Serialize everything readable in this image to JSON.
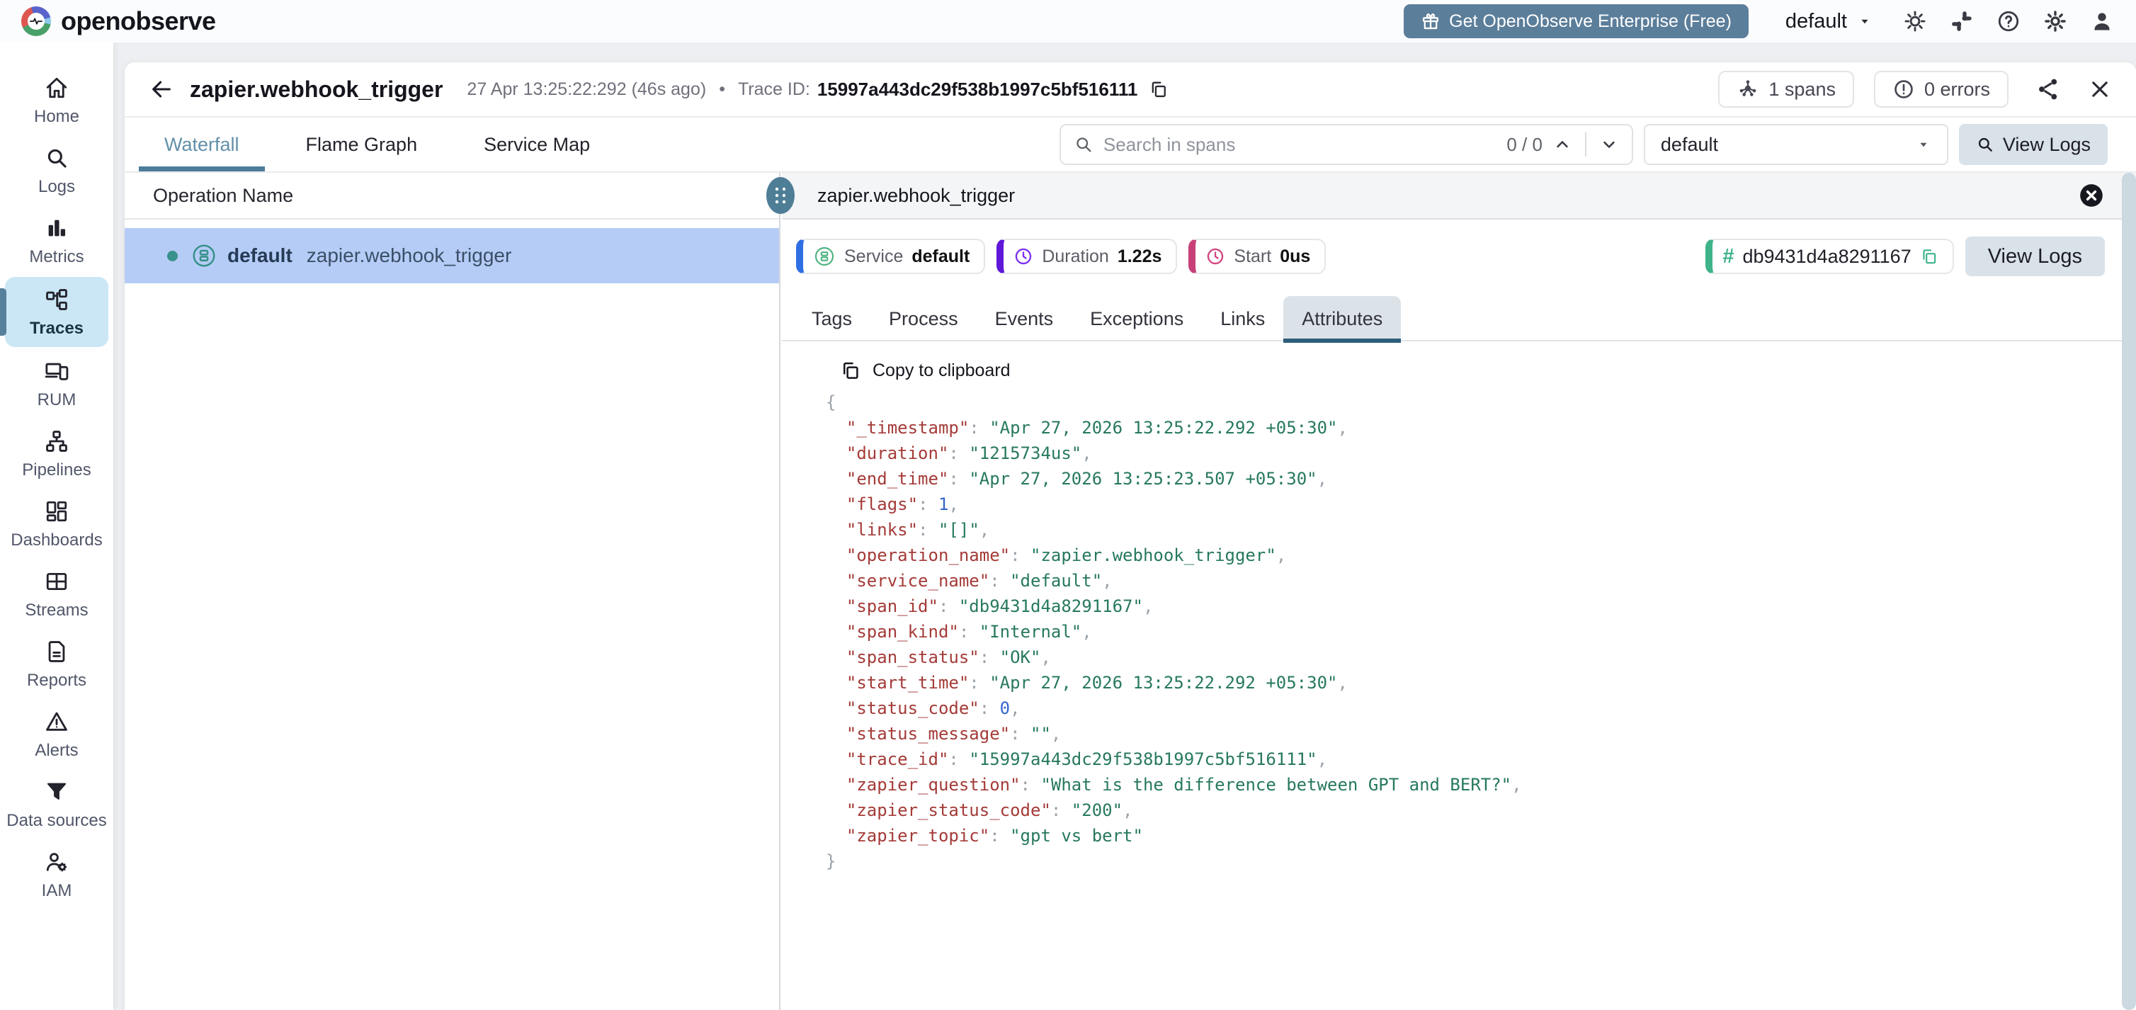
{
  "topbar": {
    "brand": "openobserve",
    "enterprise_button_label": "Get OpenObserve Enterprise (Free)",
    "org_selector_value": "default",
    "icon_names": [
      "logo-pulse-icon",
      "gift-icon",
      "caret-down-icon",
      "light-mode-icon",
      "slack-icon",
      "help-icon",
      "settings-icon",
      "profile-icon"
    ]
  },
  "sidebar": {
    "active_item": "Traces",
    "items": [
      {
        "label": "Home",
        "icon": "home-icon"
      },
      {
        "label": "Logs",
        "icon": "search-icon"
      },
      {
        "label": "Metrics",
        "icon": "bar-chart-icon"
      },
      {
        "label": "Traces",
        "icon": "trace-tree-icon"
      },
      {
        "label": "RUM",
        "icon": "devices-icon"
      },
      {
        "label": "Pipelines",
        "icon": "pipeline-icon"
      },
      {
        "label": "Dashboards",
        "icon": "dashboard-grid-icon"
      },
      {
        "label": "Streams",
        "icon": "table-icon"
      },
      {
        "label": "Reports",
        "icon": "document-icon"
      },
      {
        "label": "Alerts",
        "icon": "warning-triangle-icon"
      },
      {
        "label": "Data sources",
        "icon": "funnel-icon"
      },
      {
        "label": "IAM",
        "icon": "user-gear-icon"
      }
    ]
  },
  "trace_header": {
    "title": "zapier.webhook_trigger",
    "timestamp": "27 Apr 13:25:22:292 (46s ago)",
    "separator": "•",
    "trace_id_label": "Trace ID:",
    "trace_id_value": "15997a443dc29f538b1997c5bf516111",
    "spans_chip": "1 spans",
    "errors_chip": "0 errors"
  },
  "toolbar": {
    "tabs": [
      {
        "label": "Waterfall",
        "active": true
      },
      {
        "label": "Flame Graph",
        "active": false
      },
      {
        "label": "Service Map",
        "active": false
      }
    ],
    "search_placeholder": "Search in spans",
    "search_counter": "0 / 0",
    "stream_selector_value": "default",
    "view_logs_label": "View Logs"
  },
  "waterfall": {
    "column_header": "Operation Name",
    "rows": [
      {
        "service": "default",
        "operation": "zapier.webhook_trigger",
        "selected": true
      }
    ]
  },
  "detail_panel": {
    "title": "zapier.webhook_trigger",
    "service_label": "Service",
    "service_value": "default",
    "duration_label": "Duration",
    "duration_value": "1.22s",
    "start_label": "Start",
    "start_value": "0us",
    "span_id": "db9431d4a8291167",
    "view_logs_label": "View Logs",
    "tabs": [
      {
        "label": "Tags",
        "active": false
      },
      {
        "label": "Process",
        "active": false
      },
      {
        "label": "Events",
        "active": false
      },
      {
        "label": "Exceptions",
        "active": false
      },
      {
        "label": "Links",
        "active": false
      },
      {
        "label": "Attributes",
        "active": true
      }
    ],
    "copy_to_clipboard_label": "Copy to clipboard",
    "attributes": [
      {
        "key": "_timestamp",
        "value": "Apr 27, 2026 13:25:22.292 +05:30",
        "type": "string"
      },
      {
        "key": "duration",
        "value": "1215734us",
        "type": "string"
      },
      {
        "key": "end_time",
        "value": "Apr 27, 2026 13:25:23.507 +05:30",
        "type": "string"
      },
      {
        "key": "flags",
        "value": 1,
        "type": "number"
      },
      {
        "key": "links",
        "value": "[]",
        "type": "string"
      },
      {
        "key": "operation_name",
        "value": "zapier.webhook_trigger",
        "type": "string"
      },
      {
        "key": "service_name",
        "value": "default",
        "type": "string"
      },
      {
        "key": "span_id",
        "value": "db9431d4a8291167",
        "type": "string"
      },
      {
        "key": "span_kind",
        "value": "Internal",
        "type": "string"
      },
      {
        "key": "span_status",
        "value": "OK",
        "type": "string"
      },
      {
        "key": "start_time",
        "value": "Apr 27, 2026 13:25:22.292 +05:30",
        "type": "string"
      },
      {
        "key": "status_code",
        "value": 0,
        "type": "number"
      },
      {
        "key": "status_message",
        "value": "",
        "type": "string"
      },
      {
        "key": "trace_id",
        "value": "15997a443dc29f538b1997c5bf516111",
        "type": "string"
      },
      {
        "key": "zapier_question",
        "value": "What is the difference between GPT and BERT?",
        "type": "string"
      },
      {
        "key": "zapier_status_code",
        "value": "200",
        "type": "string"
      },
      {
        "key": "zapier_topic",
        "value": "gpt vs bert",
        "type": "string"
      }
    ]
  },
  "colors": {
    "accent_slate": "#5b7e9a",
    "selected_row": "#b5cdf6",
    "active_tab": "#6290aa",
    "active_tab_underline": "#4b7d98",
    "teal": "#39918b",
    "sidebar_active_bg": "#cbe7f6",
    "badge_service_border": "#2f6fe4",
    "badge_duration_border": "#5f17d8",
    "badge_start_border": "#c74077",
    "badge_span_border": "#3fb389",
    "json_key": "#a43b38",
    "json_string": "#27795c",
    "json_number": "#3366cc",
    "json_punct": "#9aa1a8"
  }
}
